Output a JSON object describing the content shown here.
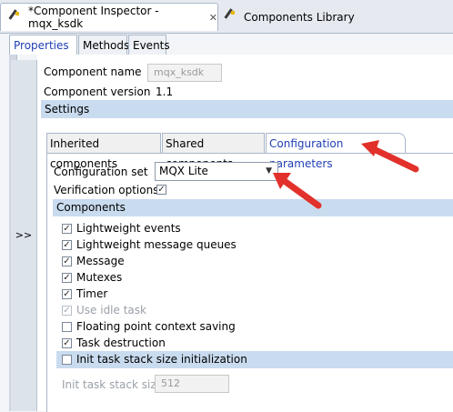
{
  "editor_tabs": [
    {
      "label": "*Component Inspector - mqx_ksdk",
      "active": true
    },
    {
      "label": "Components Library",
      "active": false
    }
  ],
  "property_tabs": [
    "Properties",
    "Methods",
    "Events"
  ],
  "expand_label": ">>",
  "component": {
    "name_label": "Component name",
    "name_value": "mqx_ksdk",
    "version_label": "Component version",
    "version_value": "1.1"
  },
  "settings_header": "Settings",
  "settings_tabs": [
    "Inherited components",
    "Shared components",
    "Configuration parameters"
  ],
  "config": {
    "set_label": "Configuration set",
    "set_value": "MQX Lite",
    "verification_label": "Verification options",
    "verification_checked": true
  },
  "components_header": "Components",
  "components_items": [
    {
      "label": "Lightweight events",
      "checked": true,
      "disabled": false
    },
    {
      "label": "Lightweight message queues",
      "checked": true,
      "disabled": false
    },
    {
      "label": "Message",
      "checked": true,
      "disabled": false
    },
    {
      "label": "Mutexes",
      "checked": true,
      "disabled": false
    },
    {
      "label": "Timer",
      "checked": true,
      "disabled": false
    },
    {
      "label": "Use idle task",
      "checked": true,
      "disabled": true
    },
    {
      "label": "Floating point context saving",
      "checked": false,
      "disabled": false
    },
    {
      "label": "Task destruction",
      "checked": true,
      "disabled": false
    }
  ],
  "init_task": {
    "label": "Init task stack size initialization",
    "checked": false,
    "stack_label": "Init task stack size",
    "stack_value": "512"
  },
  "colors": {
    "accent_blue": "#1f3fb5",
    "section_bar": "#c9dbee",
    "arrow_red": "#e2312b"
  }
}
